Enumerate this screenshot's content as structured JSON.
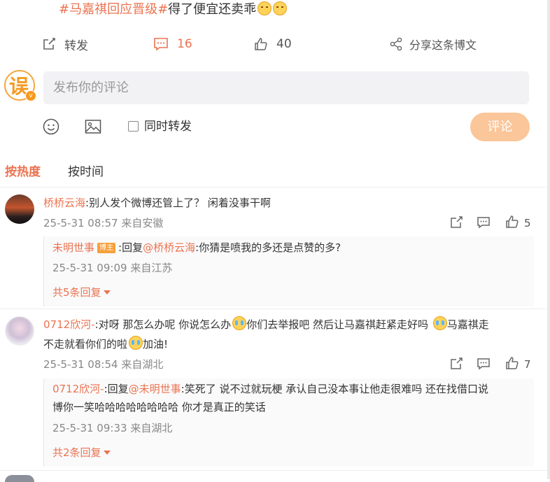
{
  "post": {
    "hashtag": "#马嘉祺回应晋级#",
    "text": "得了便宜还卖乖"
  },
  "actions": {
    "repost_label": "转发",
    "comment_count": "16",
    "like_count": "40",
    "share_label": "分享这条博文"
  },
  "composer": {
    "placeholder": "发布你的评论",
    "sync_repost_label": "同时转发",
    "submit_label": "评论"
  },
  "sort": {
    "hot_label": "按热度",
    "time_label": "按时间"
  },
  "comments": [
    {
      "user": "桥桥云海",
      "text": ":别人发个微博还管上了？ 闲着没事干啊",
      "time": "25-5-31 08:57",
      "location": "来自安徽",
      "likes": "5",
      "reply": {
        "user": "未明世事",
        "badge": "博主",
        "prefix": ":回复",
        "mention": "@桥桥云海",
        "text": ":你猜是喷我的多还是点赞的多?",
        "time": "25-5-31 09:09",
        "location": "来自江苏"
      },
      "more_label": "共5条回复"
    },
    {
      "user": "0712欣河-",
      "text_1": ":对呀 那怎么办呢 你说怎么办",
      "text_2": "你们去举报吧 然后让马嘉祺赶紧走好吗",
      "text_3": "马嘉祺走",
      "line2_a": "不走就看你们的啦",
      "line2_b": "加油!",
      "time": "25-5-31 08:54",
      "location": "来自湖北",
      "likes": "7",
      "reply": {
        "user": "0712欣河-",
        "prefix": ":回复",
        "mention": "@未明世事",
        "text_1": ":笑死了 说不过就玩梗 承认自己没本事让他走很难吗 还在找借口说",
        "text_2": "博你一笑哈哈哈哈哈哈哈哈 你才是真正的笑话",
        "time": "25-5-31 09:33",
        "location": "来自湖北"
      },
      "more_label": "共2条回复"
    }
  ],
  "colors": {
    "accent": "#eb7350",
    "submit_bg": "#fbc699",
    "input_bg": "#f2f2f5"
  },
  "icons": [
    "repost-icon",
    "comment-icon",
    "like-icon",
    "share-icon",
    "emoji-icon",
    "image-icon",
    "flag-icon",
    "reply-icon"
  ]
}
